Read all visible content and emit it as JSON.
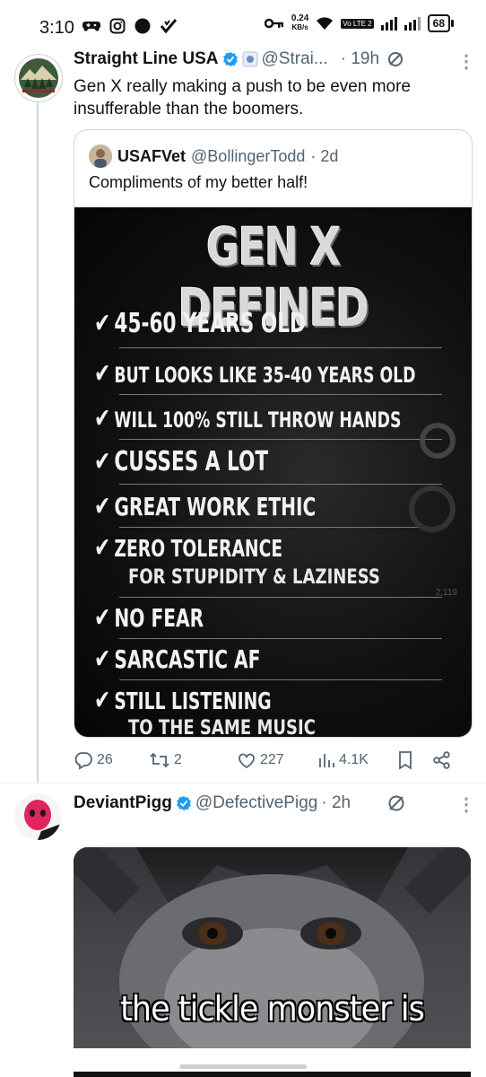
{
  "status_bar": {
    "time": "3:10",
    "net_speed_value": "0.24",
    "net_speed_unit": "KB/s",
    "volte": "Vo LTE 2",
    "battery": "68"
  },
  "tweet1": {
    "name": "Straight Line USA",
    "handle": "@Strai...",
    "time": "· 19h",
    "text": "Gen X really making a push to be even more insufferable than the boomers.",
    "quote": {
      "name": "USAFVet",
      "handle": "@BollingerTodd",
      "time": "· 2d",
      "text": "Compliments of my better half!",
      "image": {
        "title": "GEN X DEFINED",
        "items": [
          "45-60 YEARS OLD",
          "BUT LOOKS LIKE 35-40 YEARS OLD",
          "WILL 100% STILL THROW HANDS",
          "CUSSES A LOT",
          "GREAT WORK ETHIC",
          "ZERO TOLERANCE",
          "NO FEAR",
          "SARCASTIC AF",
          "STILL LISTENING"
        ],
        "sub_lines": [
          "FOR STUPIDITY & LAZINESS",
          "TO THE SAME MUSIC"
        ],
        "deco_text": "2,119"
      }
    },
    "actions": {
      "replies": "26",
      "retweets": "2",
      "likes": "227",
      "views": "4.1K"
    }
  },
  "tweet2": {
    "name": "DeviantPigg",
    "handle": "@DefectivePigg",
    "time": "· 2h",
    "image_caption": "the tickle monster is"
  },
  "icons": [
    "replies-icon",
    "retweet-icon",
    "like-icon",
    "views-icon",
    "bookmark-icon",
    "share-icon",
    "grok-icon",
    "verified-badge-icon"
  ],
  "colors": {
    "verified": "#1d9bf0",
    "secondary_text": "#536471",
    "border": "#cfd9de"
  }
}
